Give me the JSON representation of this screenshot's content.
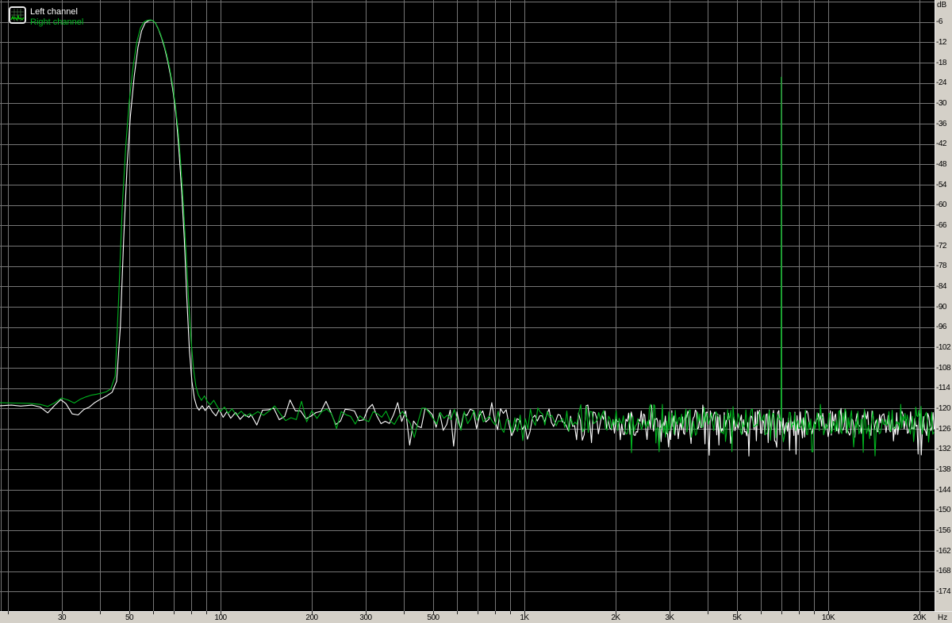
{
  "legend": {
    "left_label": "Left channel",
    "right_label": "Right channel"
  },
  "axes": {
    "y_unit": "dB",
    "x_unit": "Hz"
  },
  "colors": {
    "background": "#000000",
    "grid": "#757575",
    "plot_border": "#757575",
    "left_channel": "#ffffff",
    "right_channel": "#00b41e",
    "axis_bg": "#d4d0c8",
    "axis_text": "#000000",
    "icon_border": "#e8e8e8",
    "icon_grid": "#5a8a5a",
    "icon_trace": "#00d000"
  },
  "chart_data": {
    "type": "line",
    "title": "",
    "grid": true,
    "legend_position": "top-left",
    "x_axis": {
      "scale": "log",
      "unit": "Hz",
      "min_hz": 18.8,
      "max_hz": 22390,
      "ticks": [
        {
          "hz": 30,
          "label": "30"
        },
        {
          "hz": 50,
          "label": "50"
        },
        {
          "hz": 100,
          "label": "100"
        },
        {
          "hz": 200,
          "label": "200"
        },
        {
          "hz": 300,
          "label": "300"
        },
        {
          "hz": 500,
          "label": "500"
        },
        {
          "hz": 1000,
          "label": "1K"
        },
        {
          "hz": 2000,
          "label": "2K"
        },
        {
          "hz": 3000,
          "label": "3K"
        },
        {
          "hz": 5000,
          "label": "5K"
        },
        {
          "hz": 10000,
          "label": "10K"
        },
        {
          "hz": 20000,
          "label": "20K"
        }
      ],
      "gridlines_hz": [
        20,
        30,
        40,
        50,
        60,
        70,
        80,
        90,
        100,
        200,
        300,
        400,
        500,
        600,
        700,
        800,
        900,
        1000,
        2000,
        3000,
        4000,
        5000,
        6000,
        7000,
        8000,
        9000,
        10000,
        20000
      ]
    },
    "y_axis": {
      "unit": "dB",
      "top_db": 0,
      "bottom_db": -180,
      "grid_step_db": 6,
      "tick_labels": [
        -6,
        -12,
        -18,
        -24,
        -30,
        -36,
        -42,
        -48,
        -54,
        -60,
        -66,
        -72,
        -78,
        -84,
        -90,
        -96,
        -102,
        -108,
        -114,
        -120,
        -126,
        -132,
        -138,
        -144,
        -150,
        -156,
        -162,
        -168,
        -174
      ]
    },
    "summary": {
      "main_peak": {
        "hz": 60,
        "db": -5.5,
        "channels": "both"
      },
      "tone_spike": {
        "hz": 7000,
        "db": -22.3,
        "channel": "Right channel"
      },
      "noise_floor_db": -124
    },
    "series": [
      {
        "name": "Left channel",
        "color_key": "left_channel",
        "points": [
          [
            18.8,
            -119.2
          ],
          [
            20.5,
            -119.0
          ],
          [
            22,
            -119.3
          ],
          [
            24,
            -119.0
          ],
          [
            25.5,
            -119.6
          ],
          [
            27,
            -121.3
          ],
          [
            28.5,
            -119.0
          ],
          [
            29.8,
            -117.4
          ],
          [
            31,
            -118.6
          ],
          [
            32.5,
            -121.6
          ],
          [
            34,
            -121.9
          ],
          [
            35.5,
            -120.3
          ],
          [
            37,
            -119.6
          ],
          [
            38.5,
            -118.3
          ],
          [
            40,
            -117.4
          ],
          [
            42,
            -116.4
          ],
          [
            44,
            -115.2
          ],
          [
            45.5,
            -112.0
          ],
          [
            46.8,
            -96
          ],
          [
            48,
            -70
          ],
          [
            49.3,
            -48
          ],
          [
            50.5,
            -34
          ],
          [
            52,
            -22
          ],
          [
            53.5,
            -13.5
          ],
          [
            55,
            -8.6
          ],
          [
            56.5,
            -6.3
          ],
          [
            58,
            -5.6
          ],
          [
            59.5,
            -5.5
          ],
          [
            61,
            -6.3
          ],
          [
            62.5,
            -8.2
          ],
          [
            64,
            -10.8
          ],
          [
            65.5,
            -13.8
          ],
          [
            67,
            -17.6
          ],
          [
            68.5,
            -22
          ],
          [
            70,
            -27.5
          ],
          [
            71.5,
            -34
          ],
          [
            73,
            -44
          ],
          [
            74.5,
            -56
          ],
          [
            76,
            -70
          ],
          [
            77.5,
            -88
          ],
          [
            79,
            -103
          ],
          [
            80.5,
            -112
          ],
          [
            82,
            -117
          ],
          [
            83.5,
            -119.5
          ],
          [
            85,
            -120.5
          ],
          [
            87,
            -119.2
          ],
          [
            89,
            -120.6
          ],
          [
            91.5,
            -119.2
          ],
          [
            94,
            -121.0
          ],
          [
            96.5,
            -122.2
          ],
          [
            99,
            -120.3
          ],
          [
            102,
            -122.6
          ],
          [
            105,
            -120.9
          ],
          [
            108,
            -122.9
          ],
          [
            112,
            -121.2
          ],
          [
            116,
            -123.2
          ],
          [
            120,
            -121.8
          ],
          [
            124,
            -122.6
          ]
        ],
        "noise": {
          "start_hz": 126,
          "seed": 7,
          "base_db": -121.8,
          "base_drop_db": 2.4
        }
      },
      {
        "name": "Right channel",
        "color_key": "right_channel",
        "points": [
          [
            18.8,
            -118.3
          ],
          [
            21,
            -118.4
          ],
          [
            23.5,
            -118.5
          ],
          [
            25.5,
            -118.8
          ],
          [
            27,
            -119.4
          ],
          [
            28.5,
            -118.3
          ],
          [
            30,
            -116.9
          ],
          [
            31.5,
            -117.5
          ],
          [
            33,
            -118.4
          ],
          [
            34.5,
            -117.3
          ],
          [
            36,
            -116.6
          ],
          [
            37.5,
            -116.1
          ],
          [
            39,
            -115.8
          ],
          [
            40.5,
            -115.5
          ],
          [
            42,
            -115.1
          ],
          [
            43.5,
            -114.3
          ],
          [
            45,
            -110.5
          ],
          [
            46.2,
            -88
          ],
          [
            47.5,
            -60
          ],
          [
            48.8,
            -42
          ],
          [
            50,
            -30
          ],
          [
            51.5,
            -19.5
          ],
          [
            53,
            -12
          ],
          [
            54.5,
            -7.8
          ],
          [
            56,
            -6.0
          ],
          [
            57.5,
            -5.5
          ],
          [
            59,
            -5.4
          ],
          [
            60.5,
            -5.9
          ],
          [
            62,
            -7.4
          ],
          [
            63.5,
            -9.6
          ],
          [
            65,
            -12.3
          ],
          [
            66.5,
            -15.6
          ],
          [
            68,
            -19.6
          ],
          [
            69.5,
            -24.5
          ],
          [
            71,
            -30.5
          ],
          [
            72.5,
            -38
          ],
          [
            74,
            -48
          ],
          [
            75.5,
            -60
          ],
          [
            77,
            -74
          ],
          [
            78.5,
            -88
          ],
          [
            80,
            -100
          ],
          [
            81.5,
            -108.5
          ],
          [
            83,
            -113.5
          ],
          [
            84.5,
            -116
          ],
          [
            86.5,
            -117.6
          ],
          [
            88.5,
            -116.3
          ],
          [
            90.5,
            -118.0
          ],
          [
            92.5,
            -118.9
          ],
          [
            95,
            -117.6
          ],
          [
            97.5,
            -119.4
          ],
          [
            100,
            -120.9
          ],
          [
            103,
            -119.6
          ],
          [
            106,
            -121.4
          ],
          [
            109,
            -120.1
          ],
          [
            113,
            -122.0
          ],
          [
            117,
            -120.8
          ],
          [
            121,
            -122.3
          ],
          [
            125,
            -121.5
          ]
        ],
        "noise": {
          "start_hz": 127,
          "seed": 13,
          "base_db": -121.6,
          "base_drop_db": 2.4
        },
        "spike": {
          "from_hz": 6985,
          "to_hz": 7330,
          "points": [
            [
              6995,
              -123.8
            ],
            [
              7008,
              -22.3
            ],
            [
              7020,
              -124.5
            ],
            [
              7120,
              -129.8
            ],
            [
              7300,
              -124.5
            ]
          ]
        },
        "tail_dip": {
          "from_hz": 21200,
          "base_db": -126.3
        }
      }
    ]
  }
}
